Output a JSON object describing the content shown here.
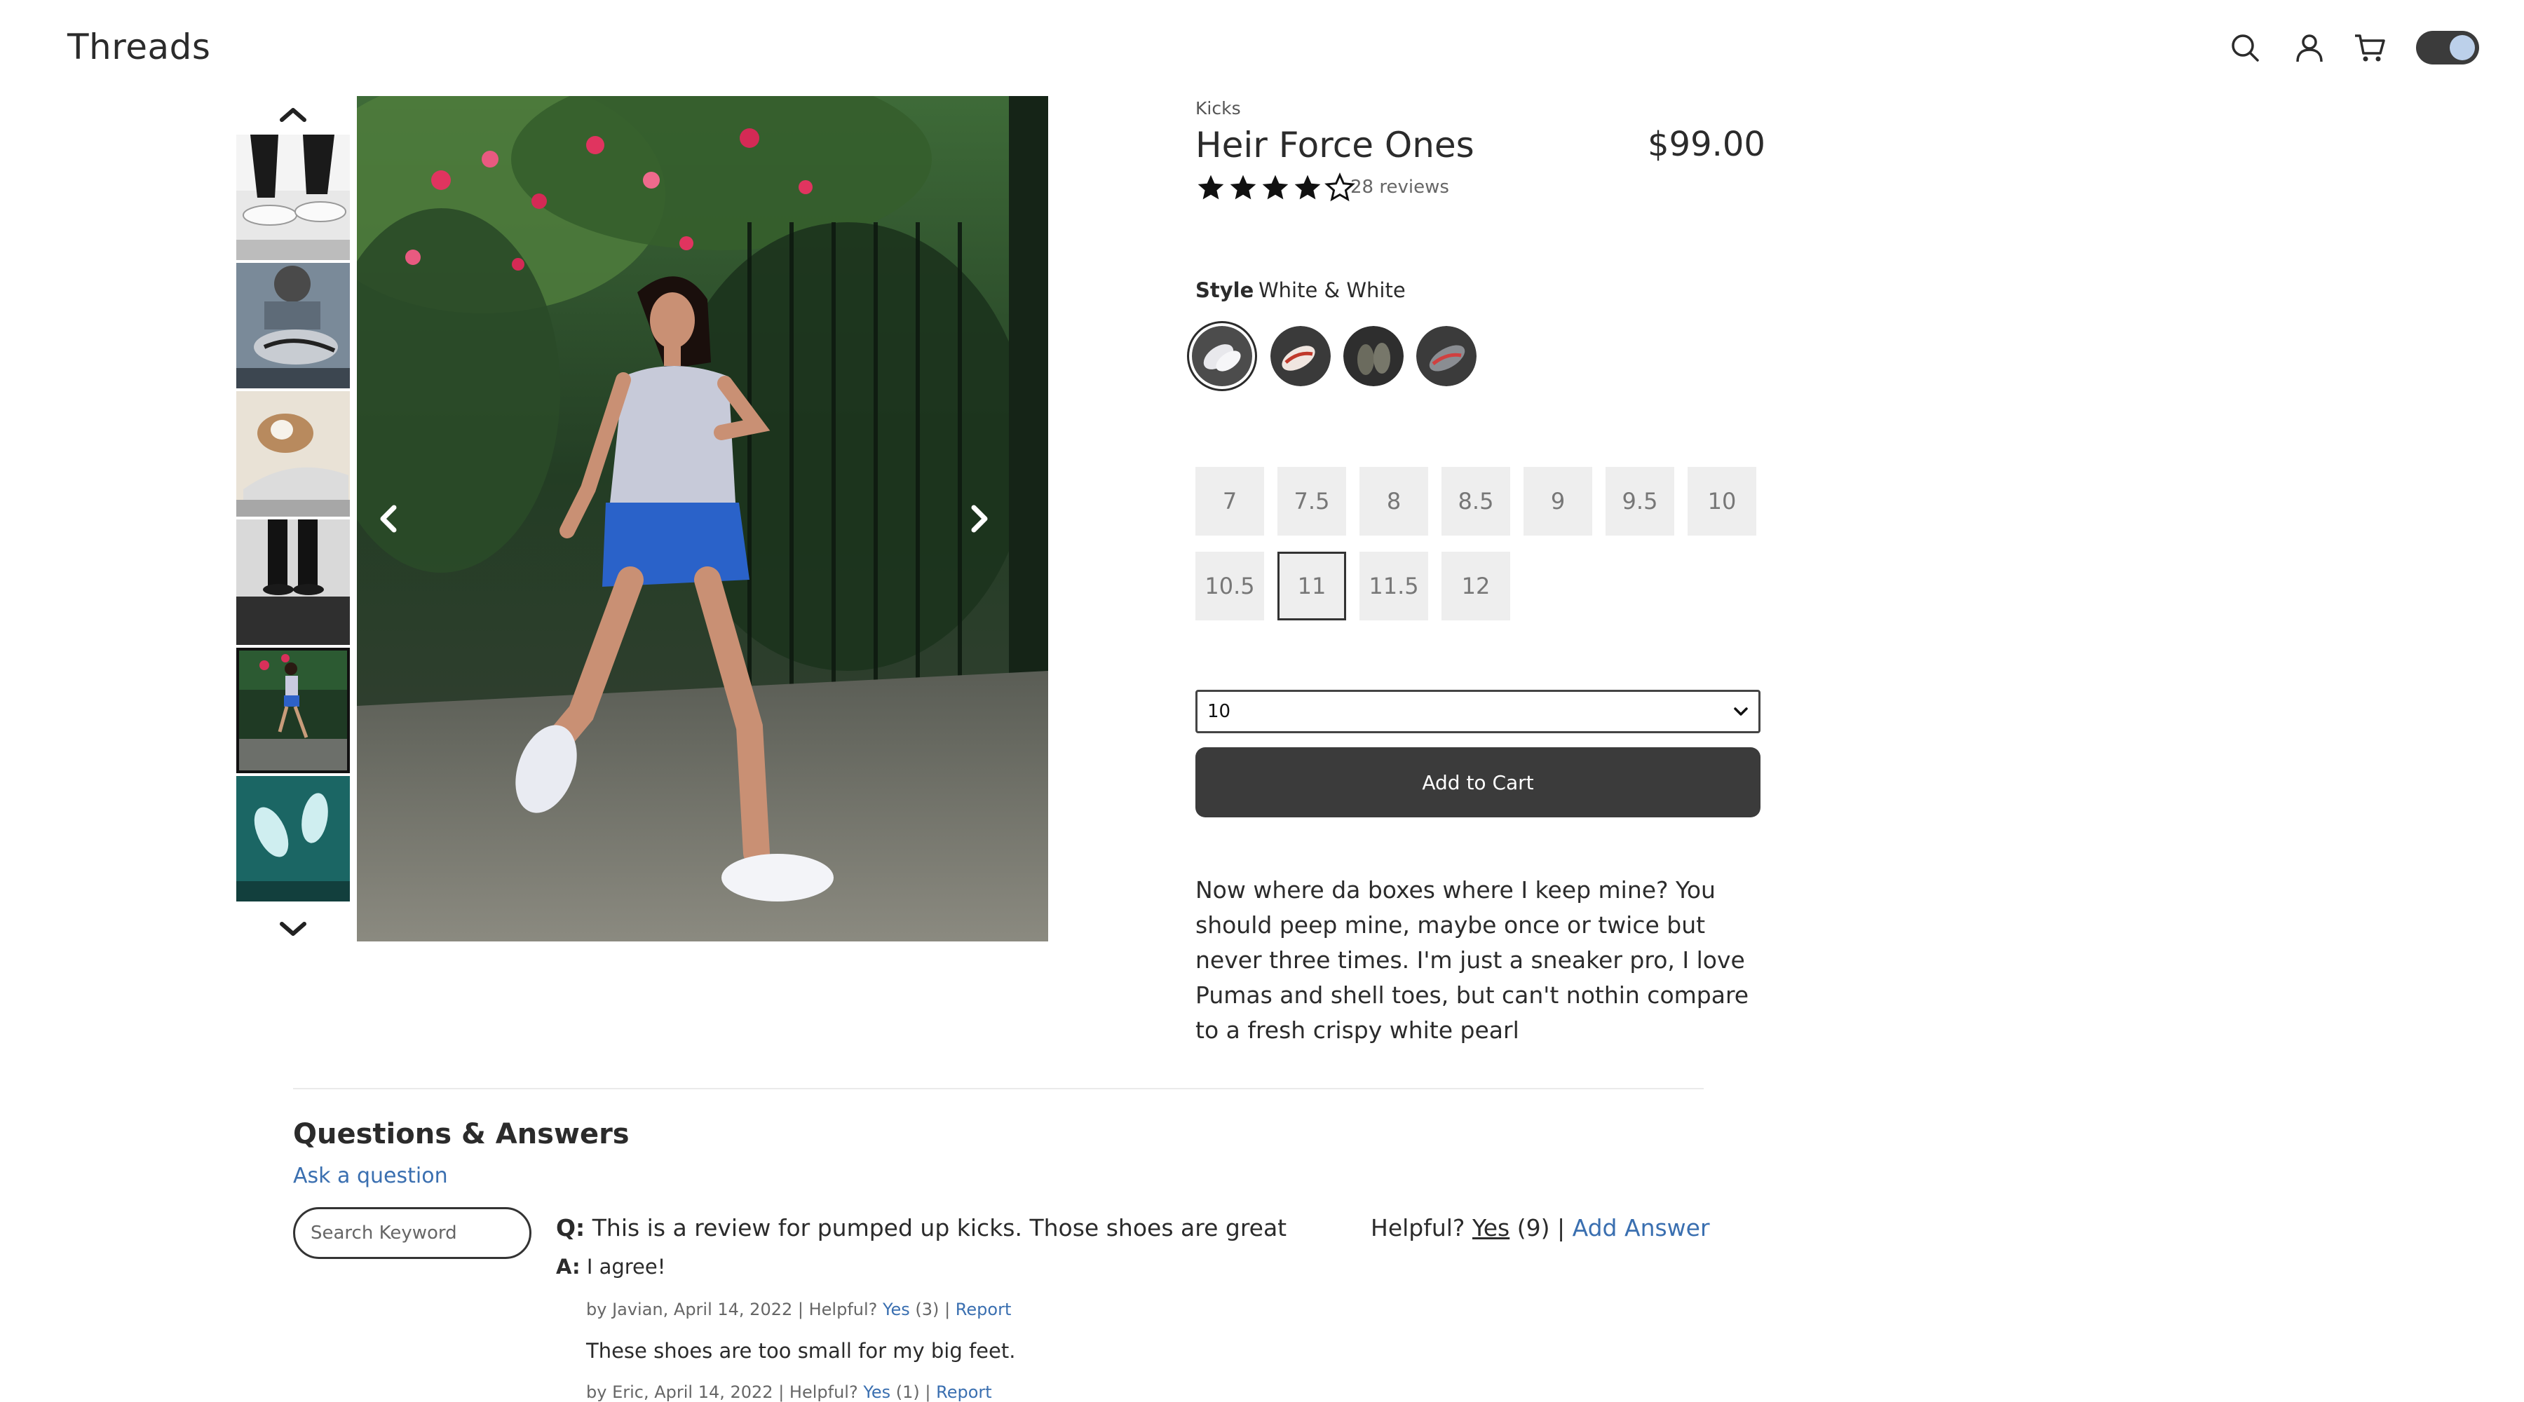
{
  "header": {
    "brand": "Threads",
    "icons": [
      "search-icon",
      "user-icon",
      "cart-icon"
    ],
    "theme_toggle": "on"
  },
  "gallery": {
    "thumbnail_count": 6,
    "selected_thumbnail_index": 4,
    "scroll_up_icon": "chevron-up-icon",
    "scroll_down_icon": "chevron-down-icon",
    "prev_icon": "chevron-left-icon",
    "next_icon": "chevron-right-icon"
  },
  "product": {
    "category": "Kicks",
    "name": "Heir Force Ones",
    "price": "$99.00",
    "rating": 4,
    "rating_max": 5,
    "reviews": "28 reviews",
    "style_label": "Style",
    "style_value": "White & White",
    "selected_style_index": 0,
    "sizes": [
      "7",
      "7.5",
      "8",
      "8.5",
      "9",
      "9.5",
      "10",
      "10.5",
      "11",
      "11.5",
      "12"
    ],
    "selected_size": "11",
    "quantity": "10",
    "add_to_cart": "Add to Cart",
    "description": "Now where da boxes where I keep mine? You should peep mine, maybe once or twice but never three times. I'm just a sneaker pro, I love Pumas and shell toes, but can't nothin compare to a fresh crispy white pearl"
  },
  "qa": {
    "title": "Questions & Answers",
    "ask_link": "Ask a question",
    "search_placeholder": "Search Keyword",
    "question_prefix": "Q:",
    "question": "This is a review for pumped up kicks. Those shoes are great",
    "helpful_label": "Helpful?",
    "helpful_yes": "Yes",
    "helpful_count": "(9)",
    "separator": "|",
    "add_answer": "Add Answer",
    "answer_prefix": "A:",
    "answers": [
      {
        "text": "I agree!",
        "meta": "by Javian, April 14, 2022 | Helpful?",
        "yes": "Yes",
        "count": "(3)",
        "sep": "|",
        "report": "Report"
      },
      {
        "text": "These shoes are too small for my big feet.",
        "meta": "by Eric, April 14, 2022 | Helpful?",
        "yes": "Yes",
        "count": "(1)",
        "sep": "|",
        "report": "Report"
      }
    ]
  }
}
